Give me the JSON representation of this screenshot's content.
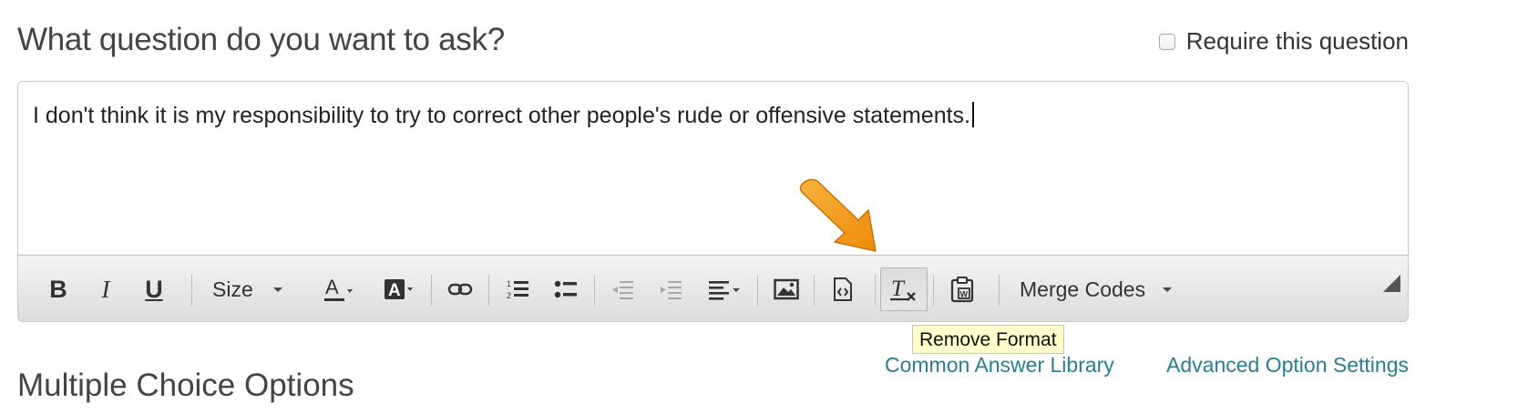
{
  "question": {
    "title": "What question do you want to ask?",
    "require_label": "Require this question",
    "require_checked": false
  },
  "editor": {
    "text": "I don't think it is my responsibility to try to correct other people's rude or offensive statements."
  },
  "toolbar": {
    "bold": "B",
    "italic": "I",
    "underline": "U",
    "size_label": "Size",
    "merge_codes_label": "Merge Codes",
    "icons": [
      "bold-icon",
      "italic-icon",
      "underline-icon",
      "text-color-icon",
      "background-color-icon",
      "link-icon",
      "numbered-list-icon",
      "bullet-list-icon",
      "decrease-indent-icon",
      "increase-indent-icon",
      "align-icon",
      "image-icon",
      "source-icon",
      "remove-format-icon",
      "paste-from-word-icon"
    ]
  },
  "tooltip": {
    "text": "Remove Format"
  },
  "links": {
    "common_answer_library": "Common Answer Library",
    "advanced_option_settings": "Advanced Option Settings"
  },
  "sections": {
    "multiple_choice": "Multiple Choice Options"
  },
  "colors": {
    "link": "#2a7d94",
    "arrow": "#f39c12",
    "tooltip_bg": "#ffffcc"
  }
}
